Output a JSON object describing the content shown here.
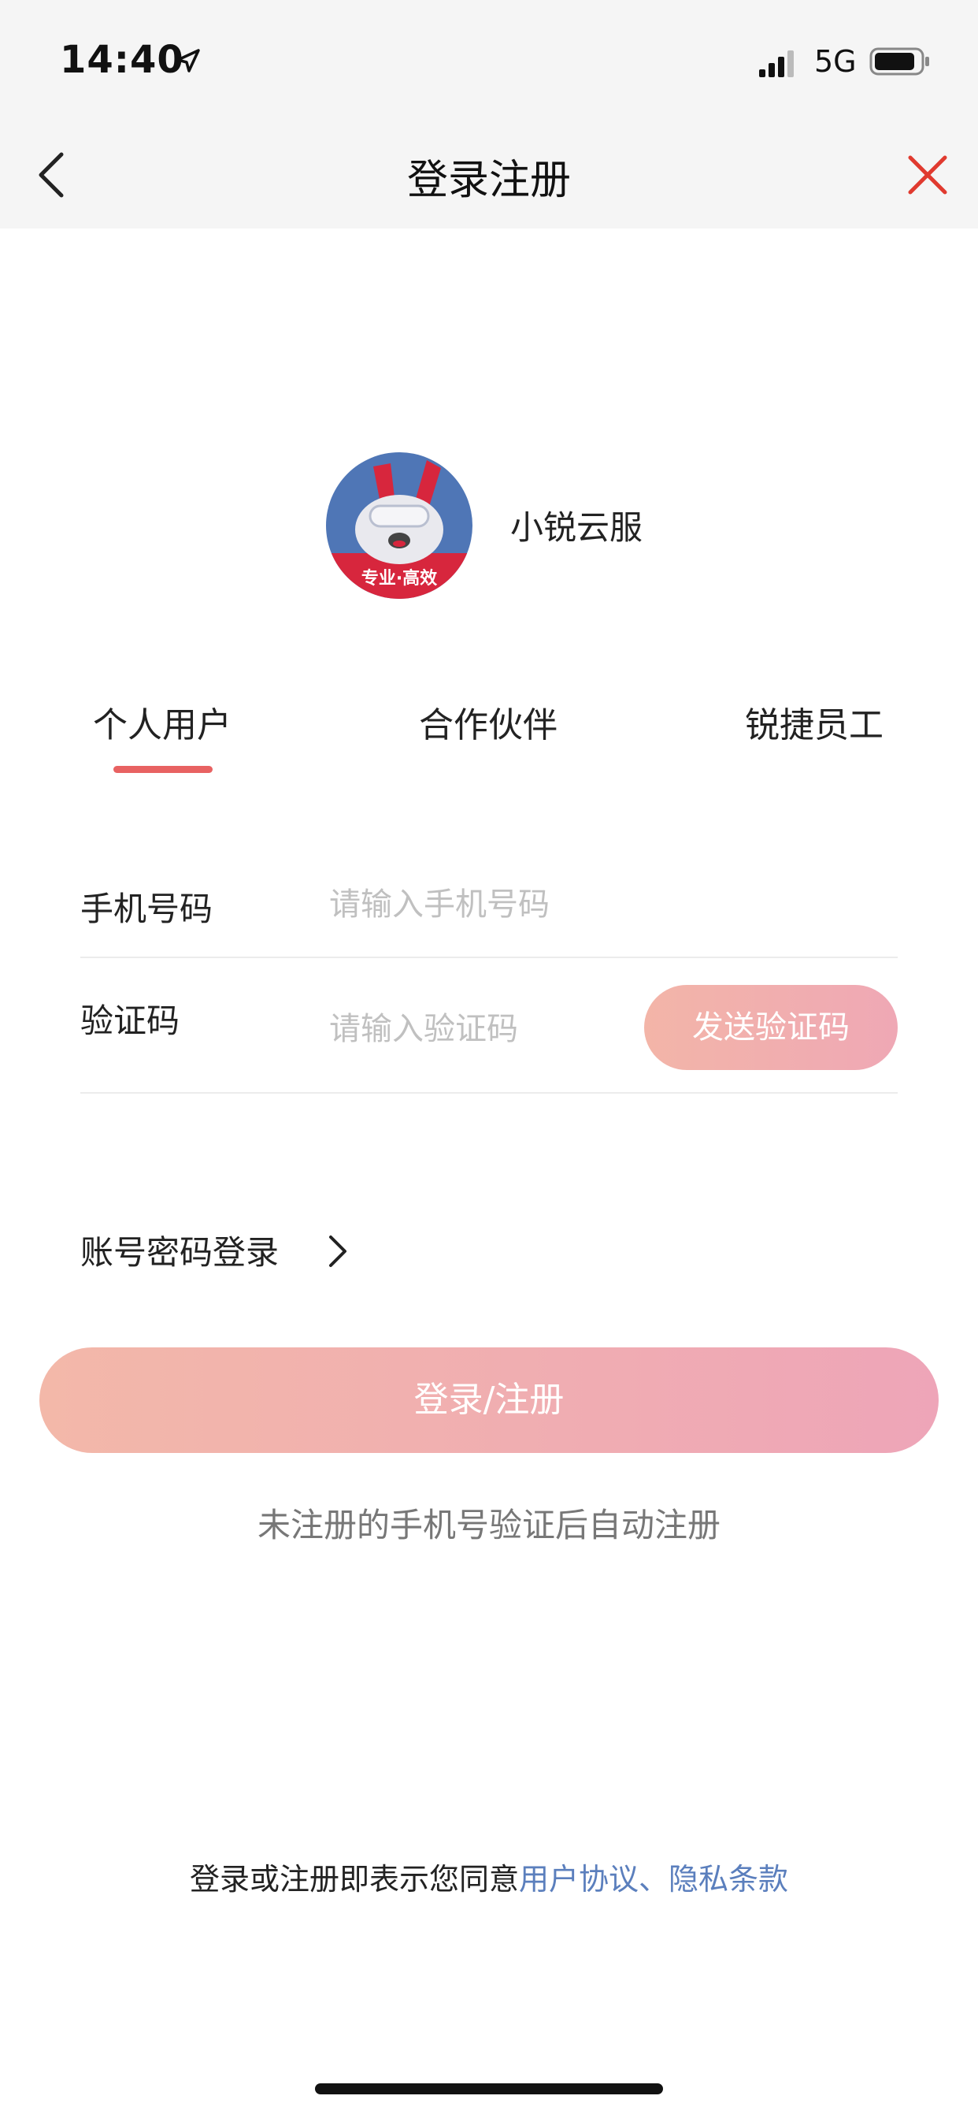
{
  "status": {
    "time": "14:40",
    "network": "5G",
    "icons": [
      "location-arrow-icon",
      "signal-icon",
      "battery-icon"
    ]
  },
  "nav": {
    "title": "登录注册",
    "back_icon": "chevron-left-icon",
    "close_icon": "close-icon",
    "close_color": "#e03a2f"
  },
  "brand": {
    "name": "小锐云服",
    "logo_badge": "专业·高效"
  },
  "tabs": [
    {
      "label": "个人用户",
      "active": true
    },
    {
      "label": "合作伙伴",
      "active": false
    },
    {
      "label": "锐捷员工",
      "active": false
    }
  ],
  "form": {
    "phone_label": "手机号码",
    "phone_placeholder": "请输入手机号码",
    "code_label": "验证码",
    "code_placeholder": "请输入验证码",
    "send_code_label": "发送验证码"
  },
  "password_login": {
    "label": "账号密码登录",
    "icon": "chevron-right-icon"
  },
  "submit_label": "登录/注册",
  "hint": "未注册的手机号验证后自动注册",
  "agreement": {
    "prefix": "登录或注册即表示您同意",
    "user_agreement": "用户协议",
    "separator": "、",
    "privacy": "隐私条款"
  },
  "colors": {
    "accent": "#e86262",
    "button_gradient_start": "#f3b8a9",
    "button_gradient_end": "#eea5b8",
    "link": "#5b7fbd"
  }
}
